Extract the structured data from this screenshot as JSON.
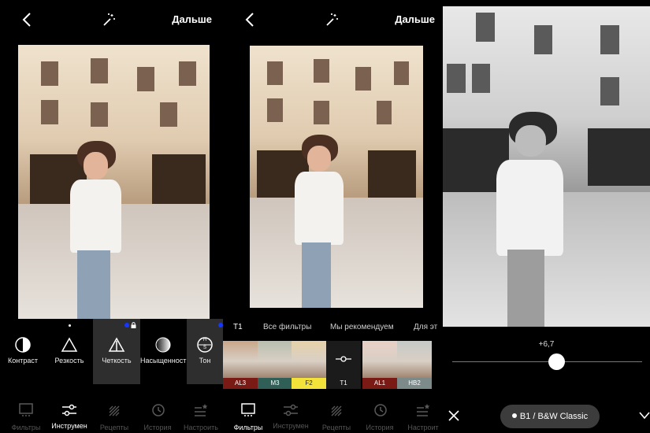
{
  "panel1": {
    "header": {
      "next_label": "Дальше"
    },
    "tools": [
      {
        "label": "Контраст",
        "icon": "contrast-icon"
      },
      {
        "label": "Резкость",
        "icon": "sharpness-triangle-icon"
      },
      {
        "label": "Четкость",
        "icon": "clarity-triangle-icon",
        "active": true
      },
      {
        "label": "Насыщенность",
        "icon": "saturation-circle-icon"
      },
      {
        "label": "Тон",
        "icon": "tone-hs-icon"
      }
    ],
    "tone_icon_letters": {
      "h": "H",
      "s": "S"
    },
    "nav": [
      {
        "label": "Фильтры",
        "icon": "filters-icon",
        "active": false
      },
      {
        "label_line1": "Инструмен",
        "label_line2": "ты",
        "icon": "tools-sliders-icon",
        "active": true
      },
      {
        "label": "Рецепты",
        "icon": "recipes-icon",
        "active": false
      },
      {
        "label": "История",
        "icon": "history-icon",
        "active": false
      },
      {
        "label": "Настроить",
        "icon": "customize-icon",
        "active": false
      }
    ]
  },
  "panel2": {
    "header": {
      "next_label": "Дальше"
    },
    "filter_tabs": [
      "T1",
      "Все фильтры",
      "Мы рекомендуем",
      "Для эт"
    ],
    "thumbnails": [
      {
        "label": "AL3",
        "caption_color": "#7a1a14"
      },
      {
        "label": "M3",
        "caption_color": "#2f5f57"
      },
      {
        "label": "F2",
        "caption_color": "#f2e23a"
      },
      {
        "label": "T1",
        "caption_color": "#1b1b1b"
      },
      {
        "label": "AL1",
        "caption_color": "#7a1a14"
      },
      {
        "label": "HB2",
        "caption_color": "#7d8a8a"
      }
    ],
    "nav": [
      {
        "label": "Фильтры",
        "icon": "filters-icon",
        "active": true
      },
      {
        "label_line1": "Инструмен",
        "label_line2": "ты",
        "icon": "tools-sliders-icon",
        "active": false
      },
      {
        "label": "Рецепты",
        "icon": "recipes-icon",
        "active": false
      },
      {
        "label": "История",
        "icon": "history-icon",
        "active": false
      },
      {
        "label": "Настроит",
        "icon": "customize-icon",
        "active": false
      }
    ]
  },
  "panel3": {
    "slider_value": "+6,7",
    "slider_level": 0.55,
    "preset_label": "B1 / B&W Classic"
  },
  "colors": {
    "background": "#000000",
    "active_tool_bg": "#2e2e2e",
    "accent_badge": "#1436ff",
    "slider_track": "#777777"
  }
}
